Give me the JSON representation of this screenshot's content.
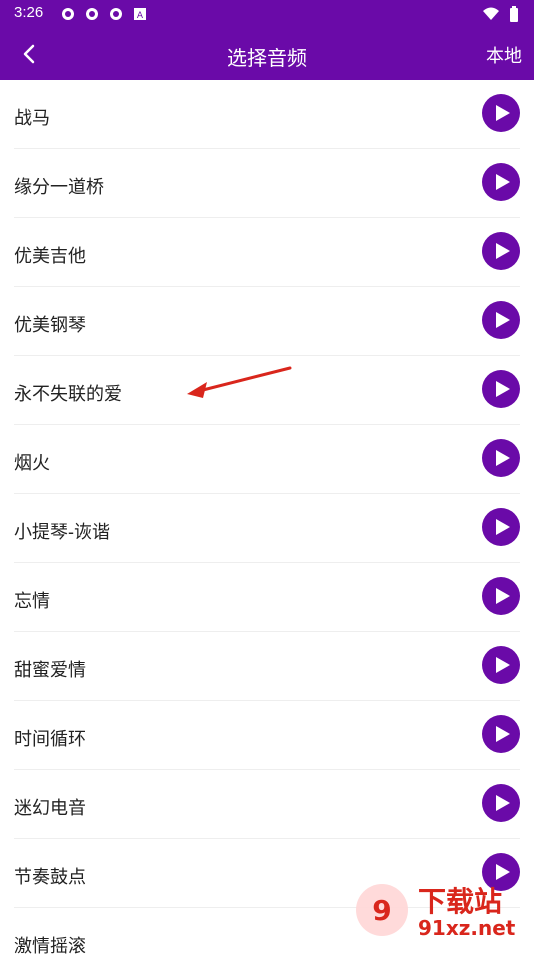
{
  "status": {
    "time": "3:26"
  },
  "header": {
    "title": "选择音频",
    "local_label": "本地"
  },
  "songs": [
    {
      "name": "战马"
    },
    {
      "name": "缘分一道桥"
    },
    {
      "name": "优美吉他"
    },
    {
      "name": "优美钢琴"
    },
    {
      "name": "永不失联的爱"
    },
    {
      "name": "烟火"
    },
    {
      "name": "小提琴-诙谐"
    },
    {
      "name": "忘情"
    },
    {
      "name": "甜蜜爱情"
    },
    {
      "name": "时间循环"
    },
    {
      "name": "迷幻电音"
    },
    {
      "name": "节奏鼓点"
    },
    {
      "name": "激情摇滚"
    }
  ],
  "watermark": {
    "text": "下载站",
    "domain": "91xz.net"
  },
  "colors": {
    "brand_purple": "#6a0aa8",
    "play_icon": "#ffffff"
  }
}
